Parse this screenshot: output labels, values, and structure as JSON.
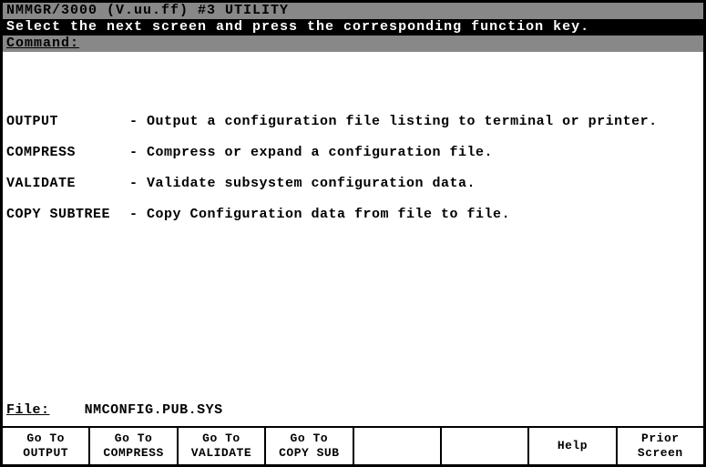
{
  "header": {
    "title": "NMMGR/3000 (V.uu.ff) #3  UTILITY",
    "instruction": "Select the next screen and press the corresponding function key.",
    "command_label": "Command:",
    "command_value": ""
  },
  "options": [
    {
      "name": "OUTPUT",
      "desc": "- Output a configuration file listing to terminal or printer."
    },
    {
      "name": "COMPRESS",
      "desc": "- Compress or expand a configuration file."
    },
    {
      "name": "VALIDATE",
      "desc": "- Validate subsystem configuration data."
    },
    {
      "name": "COPY SUBTREE",
      "desc": "- Copy Configuration data from file to file."
    }
  ],
  "file": {
    "label": "File:",
    "value": "NMCONFIG.PUB.SYS"
  },
  "fkeys": [
    {
      "line1": "Go To",
      "line2": "OUTPUT"
    },
    {
      "line1": "Go To",
      "line2": "COMPRESS"
    },
    {
      "line1": "Go To",
      "line2": "VALIDATE"
    },
    {
      "line1": "Go To",
      "line2": "COPY SUB"
    },
    {
      "line1": "",
      "line2": ""
    },
    {
      "line1": "",
      "line2": ""
    },
    {
      "line1": "Help",
      "line2": ""
    },
    {
      "line1": "Prior",
      "line2": "Screen"
    }
  ]
}
